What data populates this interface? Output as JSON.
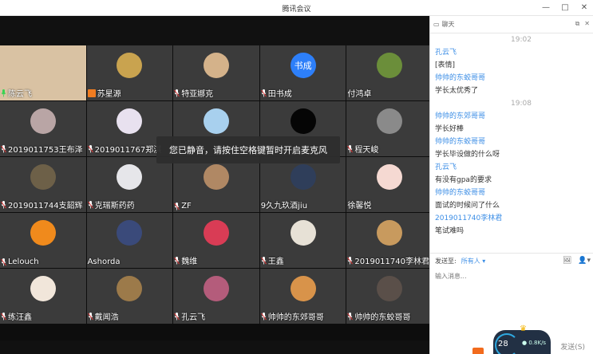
{
  "app": {
    "title": "腾讯会议",
    "window_controls": [
      "—",
      "□",
      "✕"
    ]
  },
  "video": {
    "mute_toast": "您已静音，请按住空格键暂时开启麦克风",
    "participants": [
      {
        "name": "陈云飞",
        "mic": "on",
        "camera": true,
        "avatar_color": "#d9c2a3"
      },
      {
        "name": "苏星源",
        "mic": "badge",
        "avatar_color": "#c9a34f"
      },
      {
        "name": "特亚娜克",
        "mic": "muted",
        "avatar_color": "#d4b28a"
      },
      {
        "name": "田书成",
        "mic": "muted",
        "avatar_color": "#2d7ff9",
        "initials": "书成"
      },
      {
        "name": "付鸿卓",
        "mic": "none",
        "avatar_color": "#6b8e3a"
      },
      {
        "name": "2019011753王布泽",
        "mic": "muted",
        "avatar_color": "#b9a5a5"
      },
      {
        "name": "2019011767郑淇",
        "mic": "muted",
        "avatar_color": "#e8e1ef"
      },
      {
        "name": "",
        "mic": "none",
        "avatar_color": "#a8d0ee"
      },
      {
        "name": "",
        "mic": "none",
        "avatar_color": "#050505"
      },
      {
        "name": "程天峻",
        "mic": "muted",
        "avatar_color": "#8a8a8a"
      },
      {
        "name": "2019011744支韶辉",
        "mic": "muted",
        "avatar_color": "#6d6048"
      },
      {
        "name": "克瑞斯药药",
        "mic": "muted",
        "avatar_color": "#e6e6ea"
      },
      {
        "name": "ZF",
        "mic": "muted",
        "avatar_color": "#b08864"
      },
      {
        "name": "9久九玖酒jiu",
        "mic": "none",
        "avatar_color": "#2f3e5a"
      },
      {
        "name": "徐馨悦",
        "mic": "none",
        "avatar_color": "#f5d9d2"
      },
      {
        "name": "Lelouch",
        "mic": "muted",
        "avatar_color": "#f08a1c"
      },
      {
        "name": "Ashorda",
        "mic": "none",
        "avatar_color": "#3a4a7a"
      },
      {
        "name": "魏维",
        "mic": "muted",
        "avatar_color": "#d93c55"
      },
      {
        "name": "王鑫",
        "mic": "muted",
        "avatar_color": "#e7e1d6"
      },
      {
        "name": "2019011740李林君",
        "mic": "muted",
        "avatar_color": "#c89a5e"
      },
      {
        "name": "练汪鑫",
        "mic": "muted",
        "avatar_color": "#f1e6da"
      },
      {
        "name": "戴闻浩",
        "mic": "muted",
        "avatar_color": "#9c7a4a"
      },
      {
        "name": "孔云飞",
        "mic": "muted",
        "avatar_color": "#b45c7b"
      },
      {
        "name": "帅帅的东郊哥哥",
        "mic": "muted",
        "avatar_color": "#d8934a"
      },
      {
        "name": "帅帅的东蛟哥哥",
        "mic": "muted",
        "avatar_color": "#5a4f49"
      }
    ]
  },
  "chat": {
    "title": "聊天",
    "messages": [
      {
        "type": "time",
        "text": "19:02"
      },
      {
        "type": "sender",
        "text": "孔云飞"
      },
      {
        "type": "text",
        "text": "[表情]"
      },
      {
        "type": "sender",
        "text": "帅帅的东蛟哥哥"
      },
      {
        "type": "text",
        "text": "学长太优秀了"
      },
      {
        "type": "time",
        "text": "19:08"
      },
      {
        "type": "sender",
        "text": "帅帅的东郊哥哥"
      },
      {
        "type": "text",
        "text": "学长好棒"
      },
      {
        "type": "sender",
        "text": "帅帅的东蛟哥哥"
      },
      {
        "type": "text",
        "text": "学长毕设做的什么呀"
      },
      {
        "type": "sender",
        "text": "孔云飞"
      },
      {
        "type": "text",
        "text": "有没有gpa的要求"
      },
      {
        "type": "sender",
        "text": "帅帅的东蛟哥哥"
      },
      {
        "type": "text",
        "text": "面试的时候问了什么"
      },
      {
        "type": "sender",
        "text": "2019011740李林君"
      },
      {
        "type": "text",
        "text": "笔试难吗"
      }
    ],
    "send_to_label": "发送至:",
    "send_to_value": "所有人",
    "input_placeholder": "输入消息...",
    "send_button": "发送(S)"
  },
  "network": {
    "ping": "28",
    "speed": "0.8K/s"
  }
}
